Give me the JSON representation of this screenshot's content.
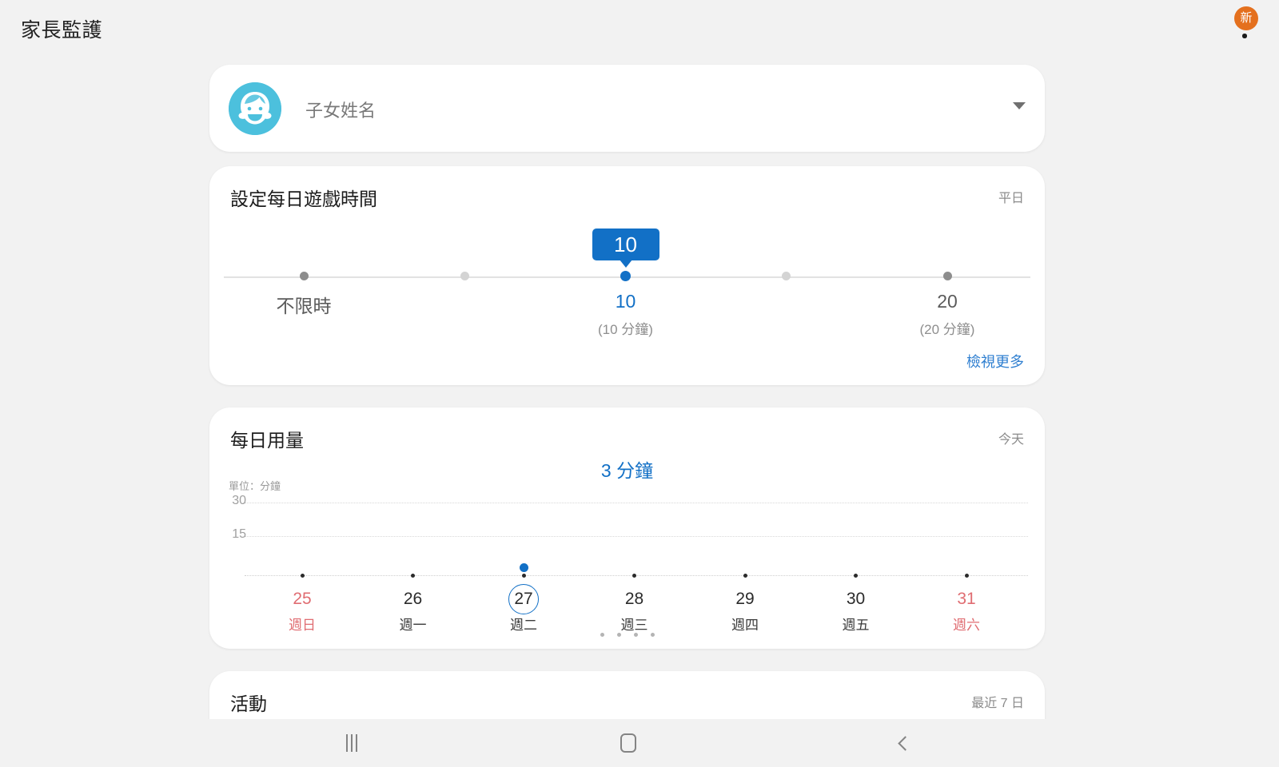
{
  "appbar": {
    "title": "家長監護",
    "menu_icon": "kebab-menu-icon",
    "badge": "新"
  },
  "profile": {
    "name": "子女姓名",
    "avatar_icon": "child-avatar-icon",
    "dropdown_icon": "chevron-down-icon",
    "avatar_color": "#4cc0dd"
  },
  "game_time": {
    "title": "設定每日遊戲時間",
    "period": "平日",
    "bubble_value": "10",
    "view_more": "檢視更多",
    "accent_color": "#1270c6",
    "ticks": [
      {
        "x_pct": 0.0,
        "label": "不限時",
        "sub": "",
        "kind": "edge",
        "selected": false
      },
      {
        "x_pct": 0.25,
        "label": "",
        "sub": "",
        "kind": "mid",
        "selected": false
      },
      {
        "x_pct": 0.5,
        "label": "10",
        "sub": "(10 分鐘)",
        "kind": "thumb",
        "selected": true
      },
      {
        "x_pct": 0.75,
        "label": "",
        "sub": "",
        "kind": "mid",
        "selected": false
      },
      {
        "x_pct": 1.0,
        "label": "20",
        "sub": "(20 分鐘)",
        "kind": "edge",
        "selected": false
      }
    ]
  },
  "daily_usage": {
    "title": "每日用量",
    "period": "今天",
    "total": "3 分鐘",
    "unit_label": "單位：分鐘",
    "pager_dots": 4
  },
  "chart_data": {
    "type": "scatter",
    "title": "每日用量",
    "subtitle": "3 分鐘",
    "ylabel": "單位：分鐘",
    "xlabel": "",
    "ylim": [
      0,
      36
    ],
    "yticks": [
      15,
      30
    ],
    "ytick_labels": [
      "15",
      "30"
    ],
    "grid": true,
    "legend": "none",
    "categories": [
      "25",
      "26",
      "27",
      "28",
      "29",
      "30",
      "31"
    ],
    "category_sublabels": [
      "週日",
      "週一",
      "週二",
      "週三",
      "週四",
      "週五",
      "週六"
    ],
    "weekend_flags": [
      true,
      false,
      false,
      false,
      false,
      false,
      true
    ],
    "values": [
      0,
      0,
      3,
      0,
      0,
      0,
      0
    ],
    "selected_index": 2,
    "point_color": "#1270c6",
    "axis_point_color": "#2b2b2b"
  },
  "activity": {
    "title": "活動",
    "period": "最近 7 日"
  },
  "navbar": {
    "recents_label": "recents-icon",
    "home_label": "home-icon",
    "back_label": "back-icon"
  }
}
